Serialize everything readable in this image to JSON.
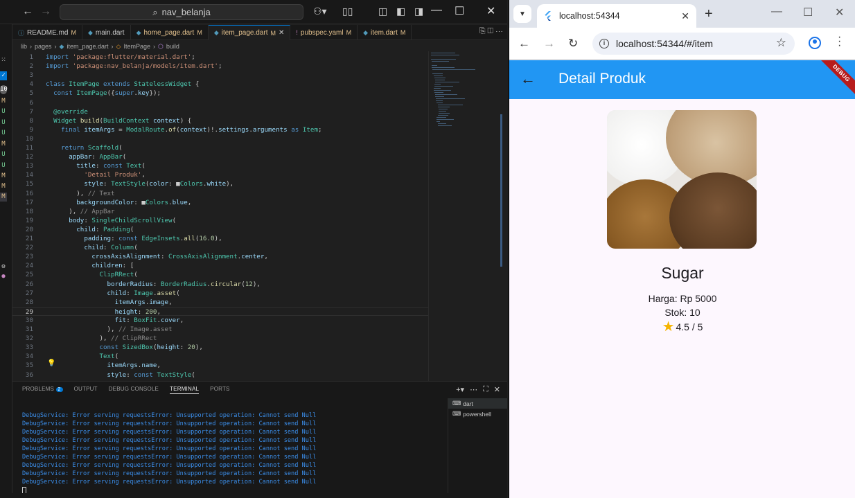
{
  "vscode": {
    "search_text": "nav_belanja",
    "tabs": [
      {
        "label": "README.md",
        "mark": "M"
      },
      {
        "label": "main.dart",
        "mark": ""
      },
      {
        "label": "home_page.dart",
        "mark": "M"
      },
      {
        "label": "item_page.dart",
        "mark": "M"
      },
      {
        "label": "pubspec.yaml",
        "mark": "M"
      },
      {
        "label": "item.dart",
        "mark": "M"
      }
    ],
    "active_tab_index": 3,
    "breadcrumb": [
      "lib",
      "pages",
      "item_page.dart",
      "ItemPage",
      "build"
    ],
    "current_line": 29,
    "code_lines": [
      "import 'package:flutter/material.dart';",
      "import 'package:nav_belanja/models/item.dart';",
      "",
      "class ItemPage extends StatelessWidget {",
      "  const ItemPage({super.key});",
      "",
      "  @override",
      "  Widget build(BuildContext context) {",
      "    final itemArgs = ModalRoute.of(context)!.settings.arguments as Item;",
      "",
      "    return Scaffold(",
      "      appBar: AppBar(",
      "        title: const Text(",
      "          'Detail Produk',",
      "          style: TextStyle(color: ■Colors.white),",
      "        ), // Text",
      "        backgroundColor: ■Colors.blue,",
      "      ), // AppBar",
      "      body: SingleChildScrollView(",
      "        child: Padding(",
      "          padding: const EdgeInsets.all(16.0),",
      "          child: Column(",
      "            crossAxisAlignment: CrossAxisAlignment.center,",
      "            children: [",
      "              ClipRRect(",
      "                borderRadius: BorderRadius.circular(12),",
      "                child: Image.asset(",
      "                  itemArgs.image,",
      "                  height: 200,",
      "                  fit: BoxFit.cover,",
      "                ), // Image.asset",
      "              ), // ClipRRect",
      "              const SizedBox(height: 20),",
      "              Text(",
      "                itemArgs.name,",
      "                style: const TextStyle("
    ],
    "activity_badges": [
      "M",
      "U",
      "U",
      "U",
      "M",
      "U",
      "U",
      "M",
      "M",
      "M"
    ],
    "panel": {
      "tabs": [
        "PROBLEMS",
        "OUTPUT",
        "DEBUG CONSOLE",
        "TERMINAL",
        "PORTS"
      ],
      "problems_count": "2",
      "active_tab": "TERMINAL",
      "terminal_lines": [
        "DebugService: Error serving requestsError: Unsupported operation: Cannot send Null",
        "DebugService: Error serving requestsError: Unsupported operation: Cannot send Null",
        "DebugService: Error serving requestsError: Unsupported operation: Cannot send Null",
        "DebugService: Error serving requestsError: Unsupported operation: Cannot send Null",
        "DebugService: Error serving requestsError: Unsupported operation: Cannot send Null",
        "DebugService: Error serving requestsError: Unsupported operation: Cannot send Null",
        "DebugService: Error serving requestsError: Unsupported operation: Cannot send Null",
        "DebugService: Error serving requestsError: Unsupported operation: Cannot send Null",
        "DebugService: Error serving requestsError: Unsupported operation: Cannot send Null"
      ],
      "terminals": [
        "dart",
        "powershell"
      ]
    }
  },
  "chrome": {
    "tab_title": "localhost:54344",
    "url": "localhost:54344/#/item"
  },
  "app": {
    "appbar_title": "Detail Produk",
    "debug_banner": "DEBUG",
    "product_name": "Sugar",
    "price": "Harga: Rp 5000",
    "stock": "Stok: 10",
    "rating": "4.5 / 5",
    "appbar_color": "#2196f3",
    "background": "#fdf7fe"
  }
}
